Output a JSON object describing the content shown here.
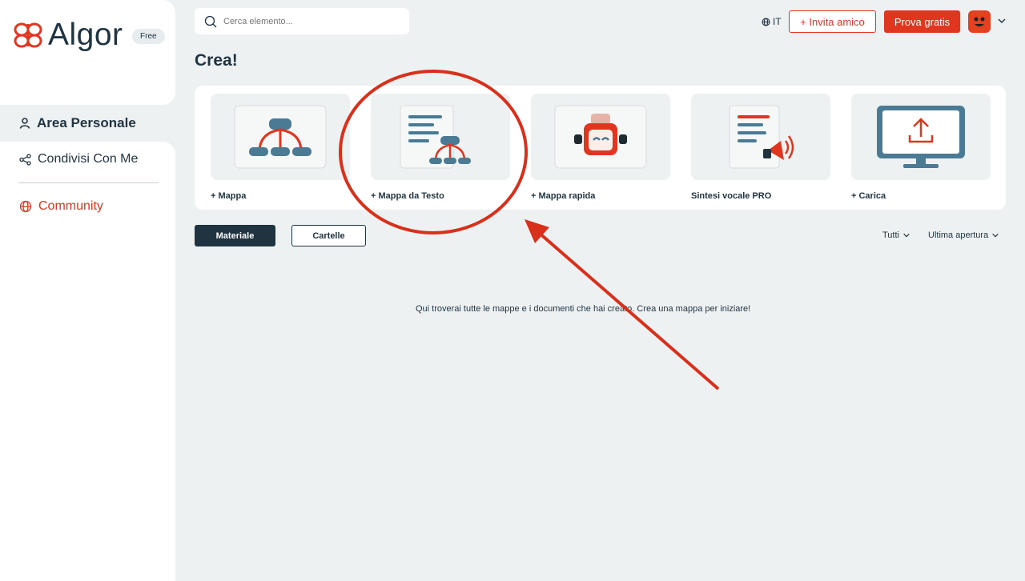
{
  "app": {
    "logo_text": "Algor",
    "plan_badge": "Free"
  },
  "sidebar": {
    "items": [
      {
        "label": "Area Personale",
        "icon": "user-icon"
      },
      {
        "label": "Condivisi Con Me",
        "icon": "share-icon"
      },
      {
        "label": "Community",
        "icon": "globe-icon"
      }
    ]
  },
  "header": {
    "search_placeholder": "Cerca elemento...",
    "language": "IT",
    "invite_label": "+ Invita amico",
    "trial_label": "Prova gratis"
  },
  "crea": {
    "title": "Crea!",
    "cards": [
      {
        "label": "+ Mappa",
        "icon": "map-icon"
      },
      {
        "label": "+ Mappa da Testo",
        "icon": "text-map-icon"
      },
      {
        "label": "+ Mappa rapida",
        "icon": "robot-icon"
      },
      {
        "label": "Sintesi vocale PRO",
        "icon": "speech-icon"
      },
      {
        "label": "+ Carica",
        "icon": "upload-icon"
      }
    ]
  },
  "content_tabs": {
    "material_label": "Materiale",
    "folders_label": "Cartelle"
  },
  "filters": {
    "type_label": "Tutti",
    "sort_label": "Ultima apertura"
  },
  "empty_message": "Qui troverai tutte le mappe e i documenti che hai creato. Crea una mappa per iniziare!",
  "colors": {
    "brand_red": "#e0351f",
    "navy": "#1f3340",
    "background": "#eef1f2",
    "annotation_red": "#d9301c"
  }
}
